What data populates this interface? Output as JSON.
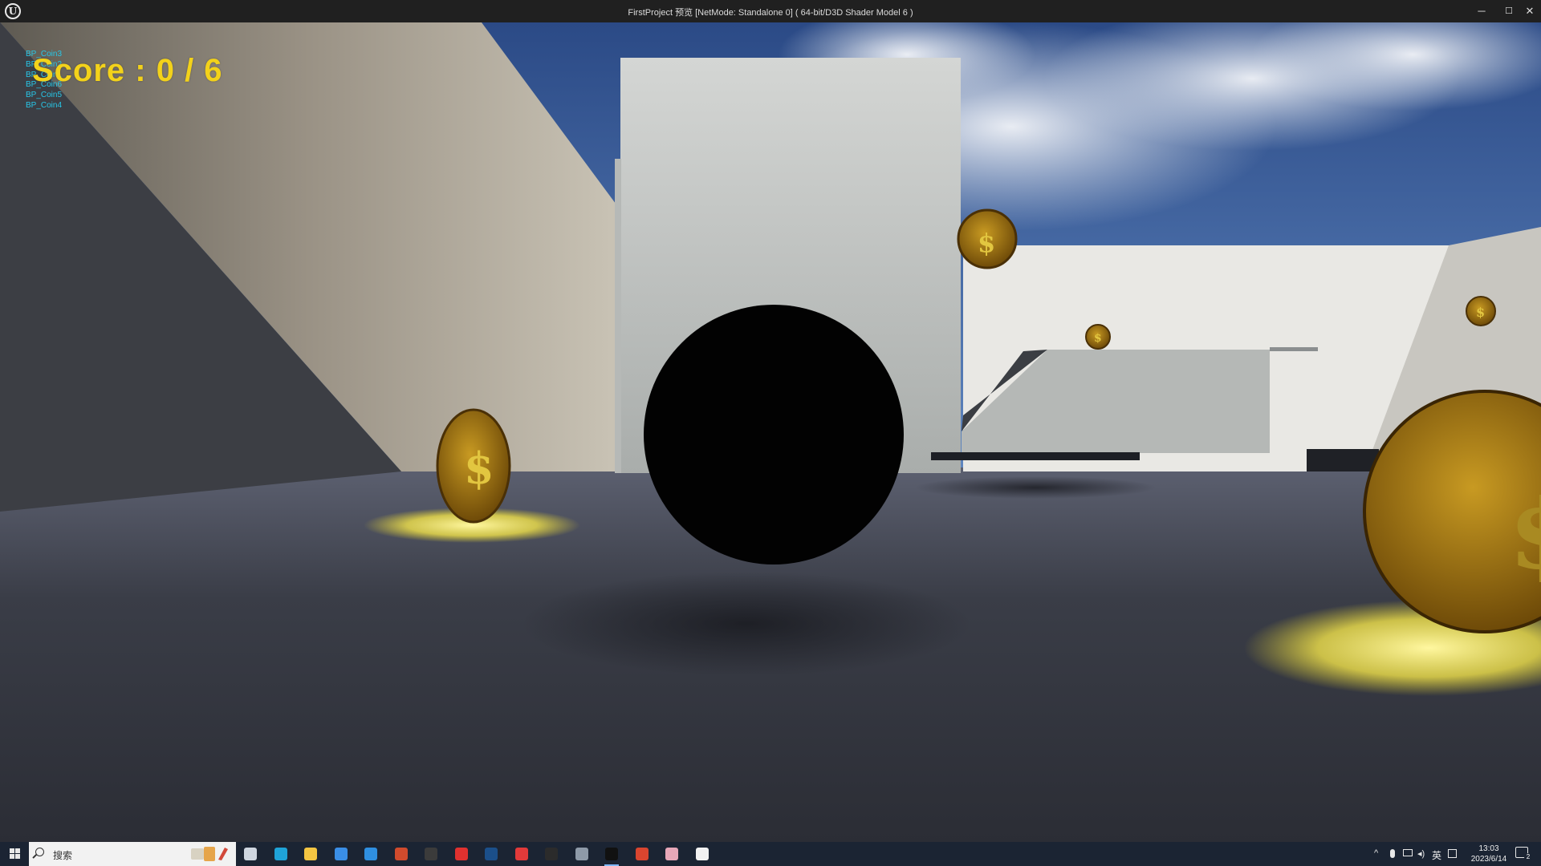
{
  "window": {
    "title": "FirstProject 预览 [NetMode: Standalone 0]  ( 64-bit/D3D Shader Model 6 )",
    "logo_icon": "unreal-engine-logo-icon",
    "minimize_glyph": "─",
    "maximize_glyph": "☐",
    "close_glyph": "✕"
  },
  "hud": {
    "score_text": "Score : 0 / 6",
    "score_color": "#f3d21a",
    "debug_actors": [
      "BP_Coin3",
      "BP_Coin2",
      "BP_Coin1",
      "BP_Coin6",
      "BP_Coin5",
      "BP_Coin4"
    ],
    "debug_color": "#27c7e8"
  },
  "scene": {
    "objects": [
      "player-ball",
      "coin",
      "coin",
      "coin",
      "coin",
      "coin",
      "white-cube",
      "wall",
      "ramp",
      "platform"
    ]
  },
  "taskbar": {
    "search_placeholder": "搜索",
    "apps": [
      {
        "name": "task-view-icon",
        "color": "#cfd6e0"
      },
      {
        "name": "edge-icon",
        "color": "#1fa3d8"
      },
      {
        "name": "file-explorer-icon",
        "color": "#f4c542"
      },
      {
        "name": "store-icon",
        "color": "#3a8ee6"
      },
      {
        "name": "mail-icon",
        "color": "#2f8fe0"
      },
      {
        "name": "powerpoint-icon",
        "color": "#d04b2d"
      },
      {
        "name": "obs-icon",
        "color": "#3b3b3b"
      },
      {
        "name": "app-red-icon",
        "color": "#e0312f"
      },
      {
        "name": "steam-icon",
        "color": "#1b4f8a"
      },
      {
        "name": "netease-music-icon",
        "color": "#e23a3a"
      },
      {
        "name": "epic-games-icon",
        "color": "#2b2b2b"
      },
      {
        "name": "app-gray-icon",
        "color": "#8e9aa8"
      },
      {
        "name": "unreal-engine-icon",
        "color": "#111111"
      },
      {
        "name": "app-puzzle-icon",
        "color": "#d9452f"
      },
      {
        "name": "app-pink-icon",
        "color": "#e7a7b8"
      },
      {
        "name": "app-white-icon",
        "color": "#f2f2f2"
      }
    ],
    "active_app": "unreal-engine-icon",
    "tray_lang": "英",
    "clock_time": "13:03",
    "clock_date": "2023/6/14",
    "notify_count": "2"
  }
}
